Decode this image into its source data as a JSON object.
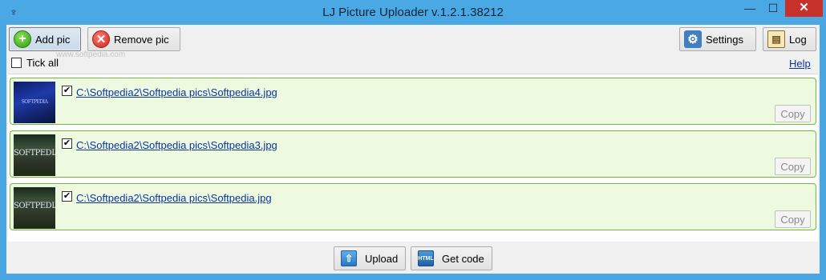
{
  "window": {
    "title": "LJ Picture Uploader v.1.2.1.38212",
    "minimize_glyph": "—",
    "maximize_glyph": "☐",
    "close_glyph": "✕"
  },
  "toolbar": {
    "add_label": "Add pic",
    "remove_label": "Remove pic",
    "settings_label": "Settings",
    "log_label": "Log"
  },
  "watermark": "www.softpedia.com",
  "tick_all": {
    "label": "Tick all",
    "checked": false
  },
  "help_label": "Help",
  "items": [
    {
      "path": "C:\\Softpedia2\\Softpedia pics\\Softpedia4.jpg",
      "checked": true,
      "copy_label": "Copy",
      "thumb_text": "SOFTPEDIA"
    },
    {
      "path": "C:\\Softpedia2\\Softpedia pics\\Softpedia3.jpg",
      "checked": true,
      "copy_label": "Copy",
      "thumb_text": "SOFTPEDIA"
    },
    {
      "path": "C:\\Softpedia2\\Softpedia pics\\Softpedia.jpg",
      "checked": true,
      "copy_label": "Copy",
      "thumb_text": "SOFTPEDIA"
    }
  ],
  "bottom": {
    "upload_label": "Upload",
    "getcode_label": "Get code"
  },
  "icons": {
    "add": "plus-icon",
    "remove": "x-icon",
    "settings": "gear-icon",
    "log": "book-icon",
    "upload": "upload-arrow-icon",
    "getcode": "html-file-icon"
  },
  "colors": {
    "titlebar": "#4aa8e4",
    "close": "#c7302b",
    "item_bg": "#eefae0",
    "item_border": "#6fb841",
    "link": "#0a33a8"
  }
}
